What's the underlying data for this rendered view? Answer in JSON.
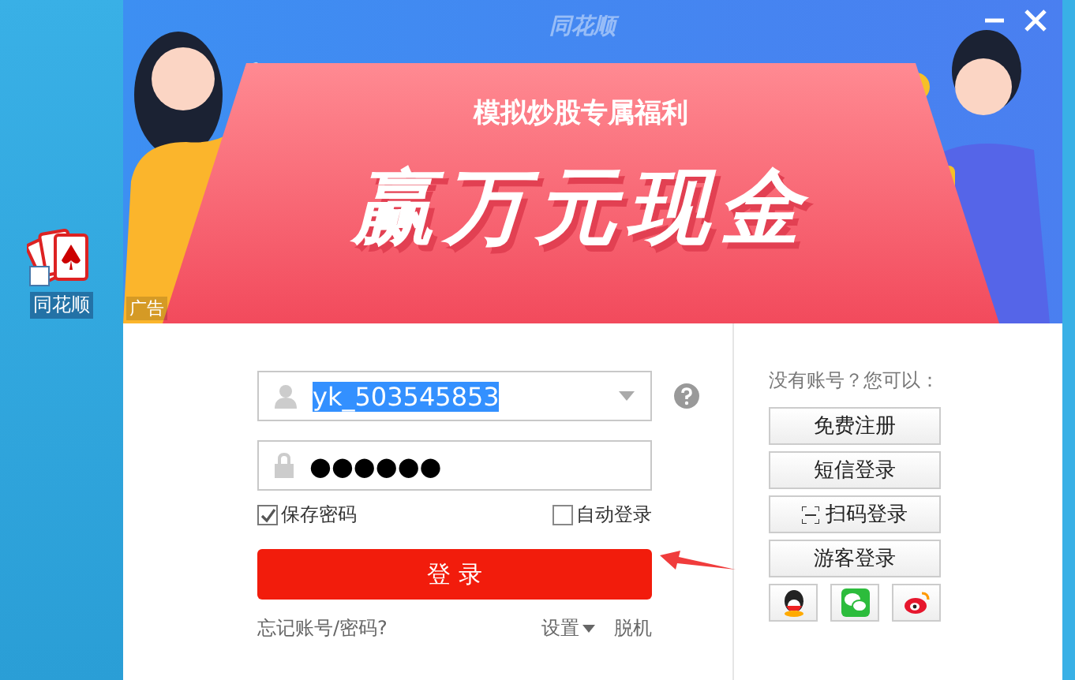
{
  "desktop": {
    "icon_label": "同花顺"
  },
  "banner": {
    "logo": "同花顺",
    "subtitle": "模拟炒股专属福利",
    "headline": "赢万元现金",
    "ad_tag": "广告"
  },
  "login": {
    "username": {
      "value": "yk_503545853",
      "selected": true
    },
    "password": {
      "value": "●●●●●●"
    },
    "options": [
      {
        "label": "保存密码",
        "checked": true
      },
      {
        "label": "自动登录",
        "checked": false
      }
    ],
    "submit": "登 录",
    "forgot": "忘记账号/密码?",
    "settings": "设置",
    "offline": "脱机"
  },
  "alternatives": {
    "prompt": "没有账号？您可以：",
    "buttons": [
      {
        "label": "免费注册",
        "kind": "plain"
      },
      {
        "label": "短信登录",
        "kind": "plain"
      },
      {
        "label": "扫码登录",
        "kind": "scan"
      },
      {
        "label": "游客登录",
        "kind": "plain"
      }
    ],
    "social": [
      {
        "kind": "qq"
      },
      {
        "kind": "wechat"
      },
      {
        "kind": "weibo"
      }
    ]
  }
}
